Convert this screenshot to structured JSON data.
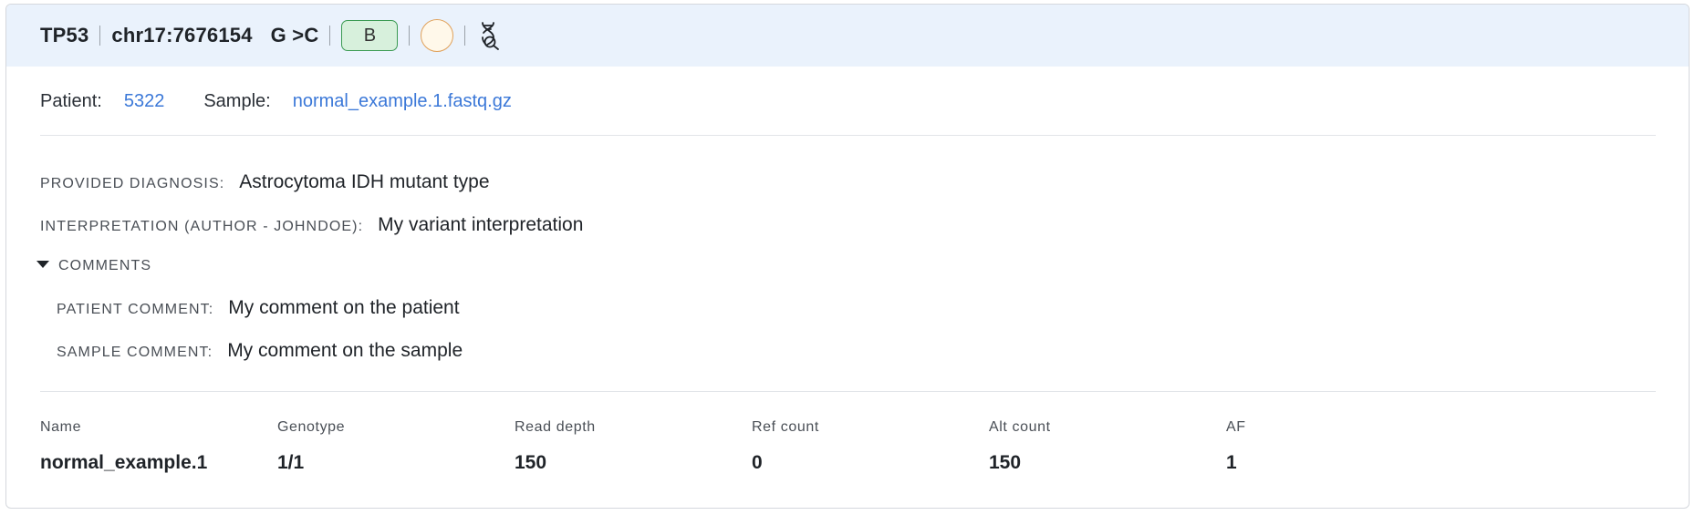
{
  "header": {
    "gene": "TP53",
    "locus": "chr17:7676154",
    "change": "G >C",
    "acmg_badge": "B",
    "status_icon": "circle-icon",
    "dna_icon": "dna-search-icon"
  },
  "links": {
    "patient_label": "Patient:",
    "patient_value": "5322",
    "sample_label": "Sample:",
    "sample_value": "normal_example.1.fastq.gz"
  },
  "details": {
    "diagnosis_label": "PROVIDED DIAGNOSIS:",
    "diagnosis_value": "Astrocytoma IDH mutant type",
    "interpretation_label": "INTERPRETATION (AUTHOR - JOHNDOE):",
    "interpretation_value": "My variant interpretation"
  },
  "comments": {
    "toggle_label": "COMMENTS",
    "patient_comment_label": "PATIENT COMMENT:",
    "patient_comment_value": "My comment on the patient",
    "sample_comment_label": "SAMPLE COMMENT:",
    "sample_comment_value": "My comment on the sample"
  },
  "table": {
    "headers": [
      "Name",
      "Genotype",
      "Read depth",
      "Ref count",
      "Alt count",
      "AF"
    ],
    "row": [
      "normal_example.1",
      "1/1",
      "150",
      "0",
      "150",
      "1"
    ]
  },
  "colors": {
    "header_bg": "#eaf2fc",
    "link": "#3b78d8",
    "acmg_benign_bg": "#d7f0dc",
    "acmg_benign_border": "#3a9a52",
    "status_circle_border": "#e0a15a"
  }
}
